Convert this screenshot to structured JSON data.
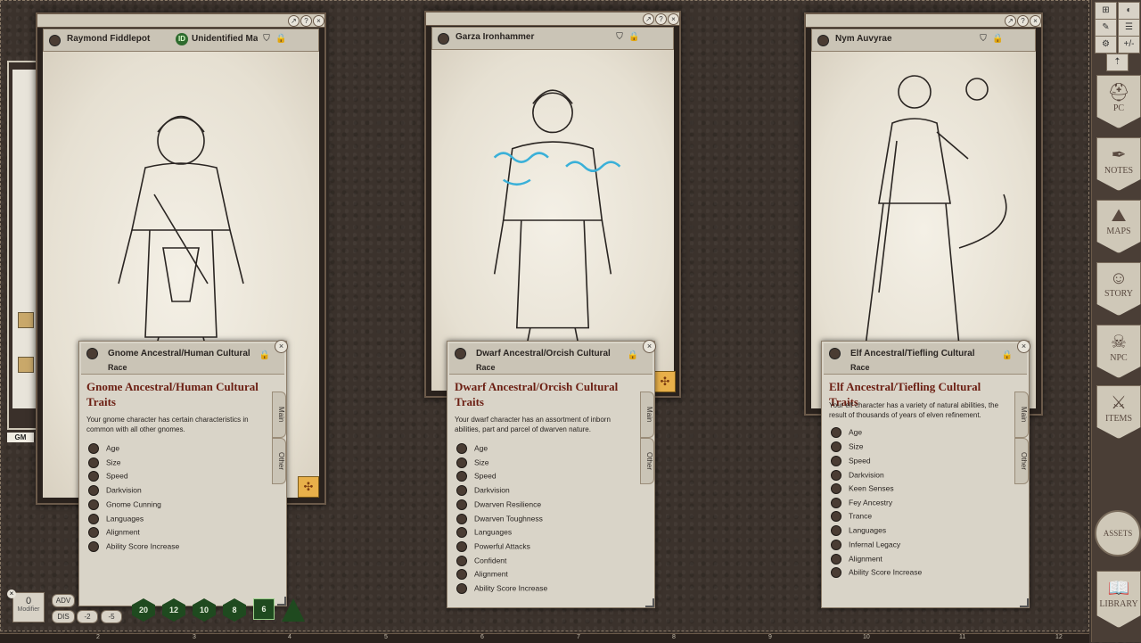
{
  "sheets": [
    {
      "name": "Raymond Fiddlepot",
      "id_label": "Unidentified Ma"
    },
    {
      "name": "Garza Ironhammer"
    },
    {
      "name": "Nym Auvyrae"
    }
  ],
  "races": [
    {
      "header": "Gnome Ancestral/Human Cultural",
      "type_label": "Race",
      "title": "Gnome Ancestral/Human Cultural Traits",
      "desc_line1": "Your gnome character has certain characteristics in",
      "desc_line2": "common with all other gnomes.",
      "traits": [
        "Age",
        "Size",
        "Speed",
        "Darkvision",
        "Gnome Cunning",
        "Languages",
        "Alignment",
        "Ability Score Increase"
      ],
      "tab_main": "Main",
      "tab_other": "Other"
    },
    {
      "header": "Dwarf Ancestral/Orcish Cultural",
      "type_label": "Race",
      "title": "Dwarf Ancestral/Orcish Cultural Traits",
      "desc_line1": "Your dwarf character has an assortment of inborn",
      "desc_line2": "abilities, part and parcel of dwarven nature.",
      "traits": [
        "Age",
        "Size",
        "Speed",
        "Darkvision",
        "Dwarven Resilience",
        "Dwarven Toughness",
        "Languages",
        "Powerful Attacks",
        "Confident",
        "Alignment",
        "Ability Score Increase"
      ],
      "tab_main": "Main",
      "tab_other": "Other"
    },
    {
      "header": "Elf Ancestral/Tiefling Cultural",
      "type_label": "Race",
      "title": "Elf Ancestral/Tiefling Cultural Traits",
      "desc_line1": "Your elf character has a variety of natural abilities, the",
      "desc_line2": "result of thousands of years of elven refinement.",
      "traits": [
        "Age",
        "Size",
        "Speed",
        "Darkvision",
        "Keen Senses",
        "Fey Ancestry",
        "Trance",
        "Languages",
        "Infernal Legacy",
        "Alignment",
        "Ability Score Increase"
      ],
      "tab_main": "Main",
      "tab_other": "Other"
    }
  ],
  "sidebar": {
    "buttons": [
      {
        "label": "PC",
        "icon": "helmet-icon"
      },
      {
        "label": "NOTES",
        "icon": "quill-icon"
      },
      {
        "label": "MAPS",
        "icon": "map-icon"
      },
      {
        "label": "STORY",
        "icon": "masks-icon"
      },
      {
        "label": "NPC",
        "icon": "demon-icon"
      },
      {
        "label": "ITEMS",
        "icon": "crossed-swords-icon"
      },
      {
        "label": "LIBRARY",
        "icon": "book-icon"
      }
    ],
    "assets_label": "ASSETS",
    "top_tools": [
      "+/-"
    ]
  },
  "bottom": {
    "gm_label": "GM",
    "modifier_value": "0",
    "modifier_label": "Modifier",
    "adv_label": "ADV",
    "dis_label": "DIS",
    "mod_minus2": "-2",
    "mod_minus5": "-5",
    "dice": [
      "20",
      "12",
      "10",
      "8",
      "6"
    ],
    "ruler": [
      "2",
      "3",
      "4",
      "5",
      "6",
      "7",
      "8",
      "9",
      "10",
      "11",
      "12"
    ]
  }
}
